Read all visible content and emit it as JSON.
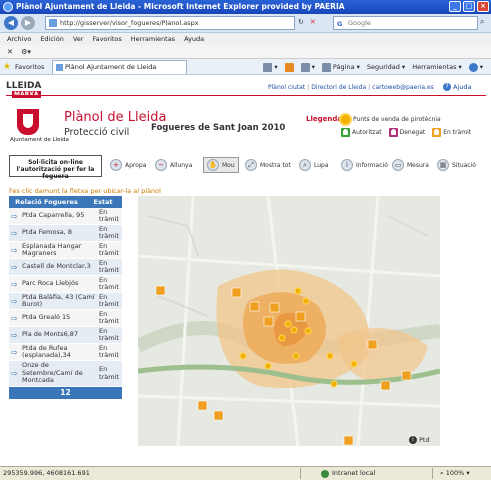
{
  "window": {
    "title": "Plànol Ajuntament de Lleida - Microsoft Internet Explorer provided by PAERIA"
  },
  "address": {
    "url": "http://gisserver/visor_fogueres/Planol.aspx",
    "search_placeholder": "Google"
  },
  "menu": [
    "Archivo",
    "Edición",
    "Ver",
    "Favoritos",
    "Herramientas",
    "Ayuda"
  ],
  "favorites": {
    "label": "Favoritos",
    "tab_title": "Plànol Ajuntament de Lleida"
  },
  "commands": [
    "Página",
    "Seguridad",
    "Herramientas"
  ],
  "header": {
    "brand": "LLEIDA",
    "brand_sub": "MARXA",
    "links": [
      "Plànol ciutat",
      "Directori de Lleida",
      "cartoweb@paeria.es"
    ],
    "help": "Ajuda",
    "org": "Ajuntament de Lleida",
    "title_prefix": "Plànol",
    "title_suffix": "de Lleida",
    "subtitle": "Protecció civil",
    "event": "Fogueres de Sant Joan 2010"
  },
  "legend": {
    "title": "Llegenda:",
    "sun_label": "Punts de venda de pirotècnia",
    "items": [
      {
        "label": "Autoritzat",
        "color": "#3aa03a"
      },
      {
        "label": "Denegat",
        "color": "#b0307a"
      },
      {
        "label": "En tràmit",
        "color": "#f0a020"
      }
    ]
  },
  "toolbar": {
    "request": "Sol·licita on-line l'autorització per fer la foguera",
    "tools": [
      "Apropa",
      "Allunya",
      "Mou",
      "Mostra tot",
      "Lupa",
      "Informació",
      "Mesura",
      "Situació"
    ]
  },
  "hint": "Fes clic damunt la fletxa per ubicar-la al plànol",
  "panel": {
    "col1": "Relació Fogueres",
    "col2": "Estat",
    "rows": [
      {
        "name": "Ptda Caparrella, 95",
        "status": "En tràmit"
      },
      {
        "name": "Ptda Femosa, 8",
        "status": "En tràmit"
      },
      {
        "name": "Esplanada Hangar Magraners",
        "status": "En tràmit"
      },
      {
        "name": "Castell de Montclar,3",
        "status": "En tràmit"
      },
      {
        "name": "Parc Roca Llebjós",
        "status": "En tràmit"
      },
      {
        "name": "Ptda Balàfia, 43 (Camí Burot)",
        "status": "En tràmit"
      },
      {
        "name": "Ptda Grealó 15",
        "status": "En tràmit"
      },
      {
        "name": "Pla de Monts6,87",
        "status": "En tràmit"
      },
      {
        "name": "Ptda de Rufea (esplanada),34",
        "status": "En tràmit"
      },
      {
        "name": "Onze de Setembre/Camí de Montcada",
        "status": "En tràmit"
      }
    ],
    "total": "12"
  },
  "map": {
    "info": "Ptd"
  },
  "status": {
    "coords": "295359.996, 4608161.691",
    "zone": "Intranet local",
    "zoom": "100%"
  }
}
